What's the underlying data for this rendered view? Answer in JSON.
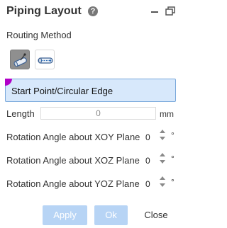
{
  "header": {
    "title": "Piping Layout",
    "help_icon": "?"
  },
  "routing": {
    "label": "Routing Method",
    "methods": [
      {
        "icon": "pipe-route-point-icon",
        "state": "active"
      },
      {
        "icon": "pipe-route-segment-icon",
        "state": "inactive"
      }
    ]
  },
  "selection": {
    "text": "Start Point/Circular Edge",
    "accent": "#b100c8"
  },
  "length": {
    "label": "Length",
    "value": "0",
    "unit": "mm"
  },
  "rotations": [
    {
      "label": "Rotation Angle about XOY Plane",
      "value": "0",
      "unit": "°"
    },
    {
      "label": "Rotation Angle about XOZ Plane",
      "value": "0",
      "unit": "°"
    },
    {
      "label": "Rotation Angle about YOZ Plane",
      "value": "0",
      "unit": "°"
    }
  ],
  "buttons": {
    "apply": "Apply",
    "ok": "Ok",
    "close": "Close"
  },
  "colors": {
    "primary_disabled": "#b7d4f5",
    "selection_bg": "#d7e8fb"
  }
}
